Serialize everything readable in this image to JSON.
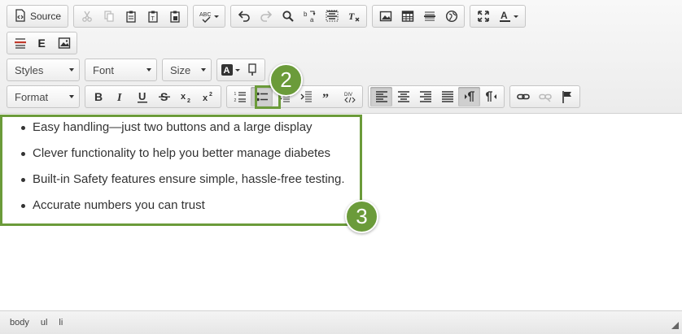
{
  "toolbar": {
    "source_label": "Source",
    "styles_label": "Styles",
    "font_label": "Font",
    "size_label": "Size",
    "format_label": "Format"
  },
  "content": {
    "items": [
      "Easy handling—just two buttons and a large display",
      "Clever functionality to help you better manage diabetes",
      "Built-in Safety features ensure simple, hassle-free testing.",
      "Accurate numbers you can trust"
    ]
  },
  "annotations": {
    "badge_2": "2",
    "badge_3": "3",
    "color": "#6b9b3a"
  },
  "statusbar": {
    "path": [
      "body",
      "ul",
      "li"
    ]
  }
}
